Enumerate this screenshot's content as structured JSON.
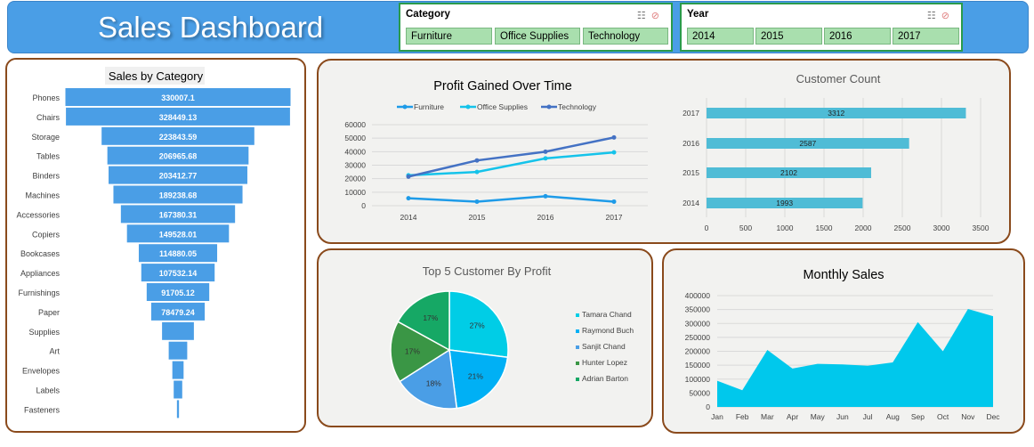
{
  "header": {
    "title": "Sales Dashboard",
    "category_slicer": {
      "title": "Category",
      "items": [
        "Furniture",
        "Office Supplies",
        "Technology"
      ]
    },
    "year_slicer": {
      "title": "Year",
      "items": [
        "2014",
        "2015",
        "2016",
        "2017"
      ]
    }
  },
  "colors": {
    "header": "#4a9ee6",
    "slicer_item": "#a9dfae",
    "panel_border": "#8a4a1c",
    "funnel": "#4a9ee6",
    "customer_bar": "#4fbcd6",
    "area": "#00c8ec"
  },
  "chart_data": [
    {
      "id": "sales_by_category",
      "type": "bar",
      "title": "Sales by Category",
      "categories": [
        "Phones",
        "Chairs",
        "Storage",
        "Tables",
        "Binders",
        "Machines",
        "Accessories",
        "Copiers",
        "Bookcases",
        "Appliances",
        "Furnishings",
        "Paper",
        "Supplies",
        "Art",
        "Envelopes",
        "Labels",
        "Fasteners"
      ],
      "values": [
        330007.1,
        328449.13,
        223843.59,
        206965.68,
        203412.77,
        189238.68,
        167380.31,
        149528.01,
        114880.05,
        107532.14,
        91705.12,
        78479.24,
        46673.54,
        27118.79,
        16476.4,
        12486.31,
        3024.28
      ],
      "labels": [
        "330007.1",
        "328449.13",
        "223843.59",
        "206965.68",
        "203412.77",
        "189238.68",
        "167380.31",
        "149528.01",
        "114880.05",
        "107532.14",
        "91705.12",
        "78479.24",
        "",
        "",
        "",
        "",
        ""
      ],
      "style": "funnel"
    },
    {
      "id": "profit_over_time",
      "type": "line",
      "title": "Profit Gained Over Time",
      "x": [
        "2014",
        "2015",
        "2016",
        "2017"
      ],
      "series": [
        {
          "name": "Furniture",
          "values": [
            5500,
            3000,
            7000,
            3000
          ],
          "color": "#1e9be8"
        },
        {
          "name": "Office Supplies",
          "values": [
            22500,
            25000,
            35000,
            39500
          ],
          "color": "#15c3ea"
        },
        {
          "name": "Technology",
          "values": [
            21500,
            33500,
            40000,
            50500
          ],
          "color": "#4472c4"
        }
      ],
      "yticks": [
        "0",
        "10000",
        "20000",
        "30000",
        "40000",
        "50000",
        "60000"
      ],
      "ylim": [
        0,
        60000
      ],
      "legend": "top"
    },
    {
      "id": "customer_count",
      "type": "bar",
      "orientation": "horizontal",
      "title": "Customer Count",
      "categories": [
        "2017",
        "2016",
        "2015",
        "2014"
      ],
      "values": [
        3312,
        2587,
        2102,
        1993
      ],
      "labels": [
        "3312",
        "2587",
        "2102",
        "1993"
      ],
      "xticks": [
        "0",
        "500",
        "1000",
        "1500",
        "2000",
        "2500",
        "3000",
        "3500"
      ],
      "xlim": [
        0,
        3500
      ]
    },
    {
      "id": "top5_customers",
      "type": "pie",
      "title": "Top 5 Customer By Profit",
      "labels": [
        "Tamara Chand",
        "Raymond Buch",
        "Sanjit Chand",
        "Hunter Lopez",
        "Adrian Barton"
      ],
      "values": [
        27,
        21,
        18,
        17,
        17
      ],
      "value_labels": [
        "27%",
        "21%",
        "18%",
        "17%",
        "17%"
      ],
      "colors": [
        "#00cde6",
        "#00b0f5",
        "#4a9ee6",
        "#3a9645",
        "#16a865"
      ],
      "legend": "right"
    },
    {
      "id": "monthly_sales",
      "type": "area",
      "title": "Monthly Sales",
      "x": [
        "Jan",
        "Feb",
        "Mar",
        "Apr",
        "May",
        "Jun",
        "Jul",
        "Aug",
        "Sep",
        "Oct",
        "Nov",
        "Dec"
      ],
      "values": [
        94000,
        60000,
        205000,
        138000,
        155000,
        153000,
        148000,
        160000,
        305000,
        200000,
        352000,
        326000
      ],
      "yticks": [
        "0",
        "50000",
        "100000",
        "150000",
        "200000",
        "250000",
        "300000",
        "350000",
        "400000"
      ],
      "ylim": [
        0,
        400000
      ]
    }
  ]
}
